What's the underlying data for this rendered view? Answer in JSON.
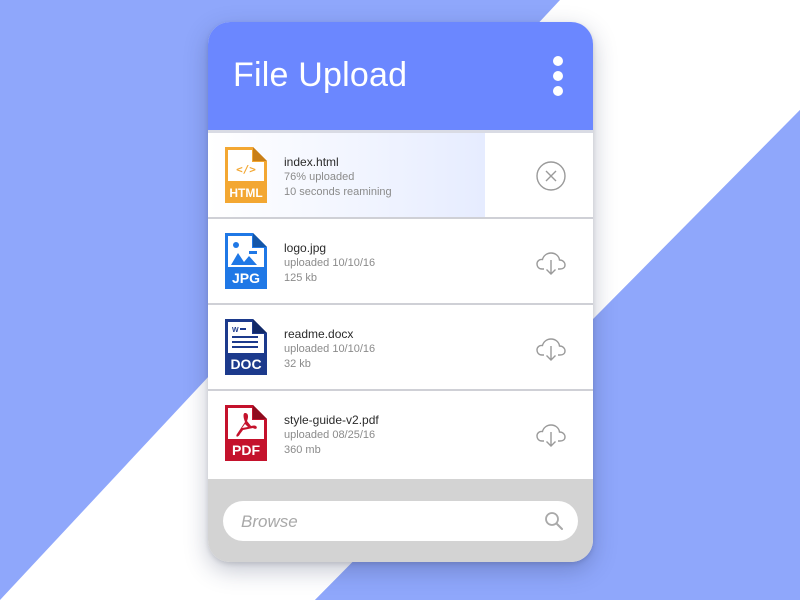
{
  "app": {
    "title": "File Upload"
  },
  "colors": {
    "accent": "#6b87ff",
    "background": "#8fa7fb",
    "footer": "#d3d3d3"
  },
  "files": [
    {
      "name": "index.html",
      "line1": "76% uploaded",
      "line2": "10 seconds reamining",
      "icon_label": "HTML",
      "icon": "html-file-icon",
      "action": "cancel-icon",
      "progress": 0.72
    },
    {
      "name": "logo.jpg",
      "line1": "uploaded 10/10/16",
      "line2": "125 kb",
      "icon_label": "JPG",
      "icon": "jpg-file-icon",
      "action": "cloud-download-icon"
    },
    {
      "name": "readme.docx",
      "line1": "uploaded 10/10/16",
      "line2": "32 kb",
      "icon_label": "DOC",
      "icon": "doc-file-icon",
      "action": "cloud-download-icon"
    },
    {
      "name": "style-guide-v2.pdf",
      "line1": "uploaded 08/25/16",
      "line2": "360 mb",
      "icon_label": "PDF",
      "icon": "pdf-file-icon",
      "action": "cloud-download-icon"
    }
  ],
  "search": {
    "placeholder": "Browse"
  }
}
